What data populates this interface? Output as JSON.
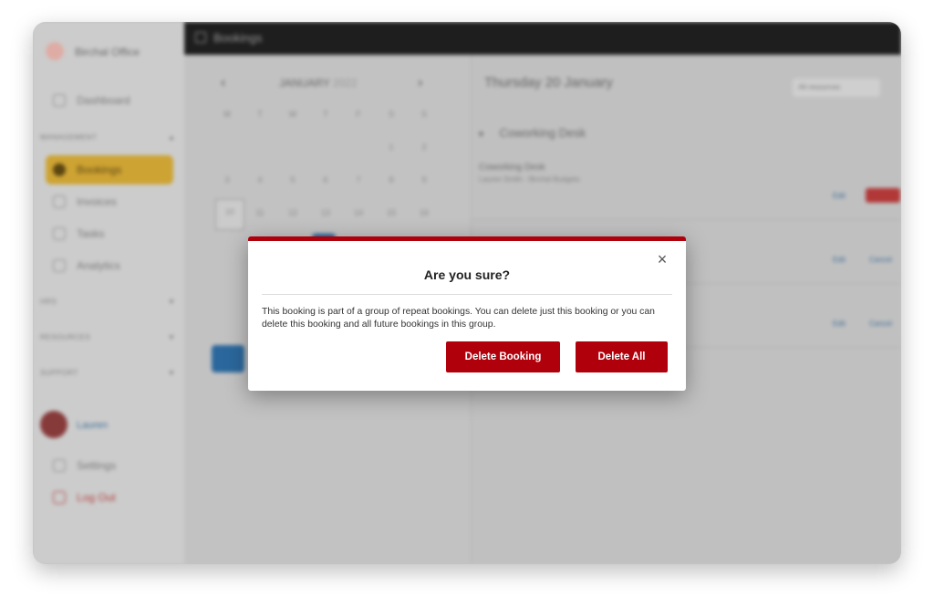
{
  "app": {
    "company": "Birchal Office",
    "topbar_title": "Bookings"
  },
  "sidebar": {
    "dashboard": "Dashboard",
    "sections": [
      "MANAGEMENT",
      "HRS",
      "RESOURCES",
      "SUPPORT"
    ],
    "items": [
      {
        "label": "Bookings"
      },
      {
        "label": "Invoices"
      },
      {
        "label": "Tasks"
      },
      {
        "label": "Analytics"
      }
    ],
    "user": "Lauren",
    "settings": "Settings",
    "logout": "Log Out"
  },
  "calendar": {
    "month": "JANUARY",
    "year": "2022",
    "weekdays": [
      "M",
      "T",
      "W",
      "T",
      "F",
      "S",
      "S"
    ],
    "rows": [
      [
        "",
        "",
        "",
        "",
        "",
        "1",
        "2"
      ],
      [
        "3",
        "4",
        "5",
        "6",
        "7",
        "8",
        "9"
      ],
      [
        "10",
        "11",
        "12",
        "13",
        "14",
        "15",
        "16"
      ]
    ]
  },
  "main": {
    "date_heading": "Thursday 20 January",
    "filter_label": "All resources",
    "group_title": "Coworking Desk",
    "booking_title": "Coworking Desk",
    "booking_sub": "Lauren Smith - Birchal Budgets",
    "edit": "Edit",
    "cancel": "Cancel"
  },
  "modal": {
    "title": "Are you sure?",
    "body": "This booking is part of a group of repeat bookings. You can delete just this booking or you can delete this booking and all future bookings in this group.",
    "delete_one_label": "Delete Booking",
    "delete_all_label": "Delete All",
    "close_glyph": "×"
  },
  "colors": {
    "accent_red": "#b0000c",
    "sidebar_active": "#d2a735",
    "topbar": "#1f1f1f"
  }
}
